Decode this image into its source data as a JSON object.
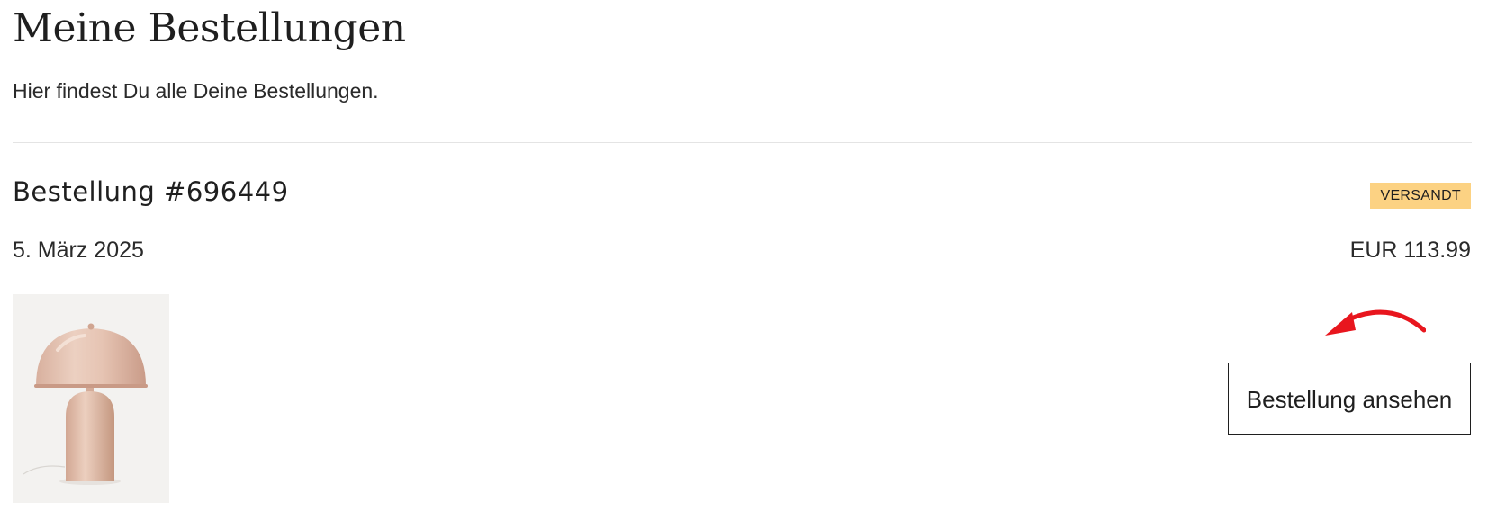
{
  "page": {
    "title": "Meine Bestellungen",
    "subtitle": "Hier findest Du alle Deine Bestellungen."
  },
  "order": {
    "number_label": "Bestellung #696449",
    "status": "VERSANDT",
    "date": "5. März 2025",
    "total": "EUR 113.99",
    "view_button_label": "Bestellung ansehen",
    "product_image": "mushroom-table-lamp-image"
  },
  "colors": {
    "status_badge_bg": "#fcd283",
    "annotation_arrow": "#e8161e",
    "text": "#1f1f1f"
  }
}
